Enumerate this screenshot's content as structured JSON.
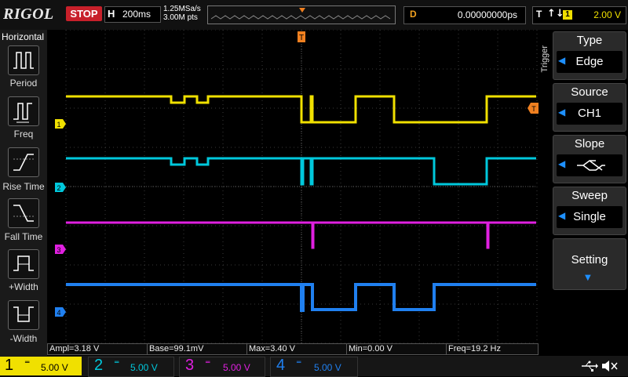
{
  "header": {
    "logo": "RIGOL",
    "run_state": "STOP",
    "horizontal": {
      "label": "H",
      "value": "200ms"
    },
    "sample_rate": "1.25MSa/s",
    "memory_depth": "3.00M pts",
    "delay": {
      "label": "D",
      "value": "0.00000000ps"
    },
    "trigger": {
      "label": "T",
      "edge_symbol": "↑↓",
      "source_num": "1",
      "level": "2.00 V"
    }
  },
  "left_panel": {
    "title": "Horizontal",
    "items": [
      {
        "label": "Period",
        "icon": "period-icon"
      },
      {
        "label": "Freq",
        "icon": "freq-icon"
      },
      {
        "label": "Rise Time",
        "icon": "rise-time-icon"
      },
      {
        "label": "Fall Time",
        "icon": "fall-time-icon"
      },
      {
        "label": "+Width",
        "icon": "pos-width-icon"
      },
      {
        "label": "-Width",
        "icon": "neg-width-icon"
      }
    ]
  },
  "right_panel": {
    "section_label": "Trigger",
    "type": {
      "label": "Type",
      "value": "Edge"
    },
    "source": {
      "label": "Source",
      "value": "CH1"
    },
    "slope": {
      "label": "Slope",
      "value_icon": "either-edge-icon"
    },
    "sweep": {
      "label": "Sweep",
      "value": "Single"
    },
    "setting": {
      "label": "Setting"
    }
  },
  "measurements": {
    "ampl": "Ampl=3.18 V",
    "base": "Base=99.1mV",
    "max": "Max=3.40 V",
    "min": "Min=0.00 V",
    "freq": "Freq=19.2 Hz"
  },
  "channels": [
    {
      "num": "1",
      "scale": "5.00 V",
      "color": "#f0e000"
    },
    {
      "num": "2",
      "scale": "5.00 V",
      "color": "#00c8dc"
    },
    {
      "num": "3",
      "scale": "5.00 V",
      "color": "#e020e0"
    },
    {
      "num": "4",
      "scale": "5.00 V",
      "color": "#2080f0"
    }
  ],
  "status_icons": [
    "usb-icon",
    "speaker-muted-icon"
  ],
  "colors": {
    "trigger_marker": "#f08020",
    "accent": "#1e90ff",
    "stop": "#c8202a"
  }
}
